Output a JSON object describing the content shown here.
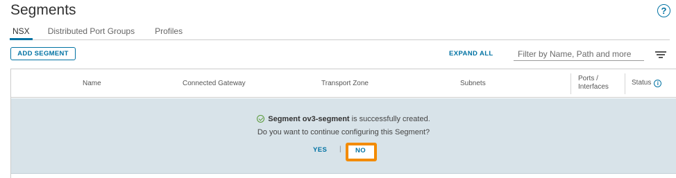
{
  "header": {
    "title": "Segments",
    "help_icon": "?"
  },
  "tabs": [
    {
      "label": "NSX",
      "active": true
    },
    {
      "label": "Distributed Port Groups",
      "active": false
    },
    {
      "label": "Profiles",
      "active": false
    }
  ],
  "toolbar": {
    "add_label": "ADD SEGMENT",
    "expand_label": "EXPAND ALL",
    "filter_placeholder": "Filter by Name, Path and more",
    "filter_value": "",
    "filter_icon": "filter-lines-icon"
  },
  "grid": {
    "columns": {
      "name": "Name",
      "gateway": "Connected Gateway",
      "transport": "Transport Zone",
      "subnets": "Subnets",
      "ports_line1": "Ports /",
      "ports_line2": "Interfaces",
      "status": "Status",
      "status_info_icon": "i"
    }
  },
  "banner": {
    "segment_label": "Segment ov3-segment",
    "created_text": " is successfully created.",
    "question": "Do you want to continue configuring this Segment?",
    "yes_label": "YES",
    "separator": "|",
    "no_label": "NO"
  },
  "colors": {
    "accent": "#0072a3",
    "highlight": "#f38b00",
    "banner_bg": "#d8e3e9",
    "success": "#5a9a3a"
  }
}
